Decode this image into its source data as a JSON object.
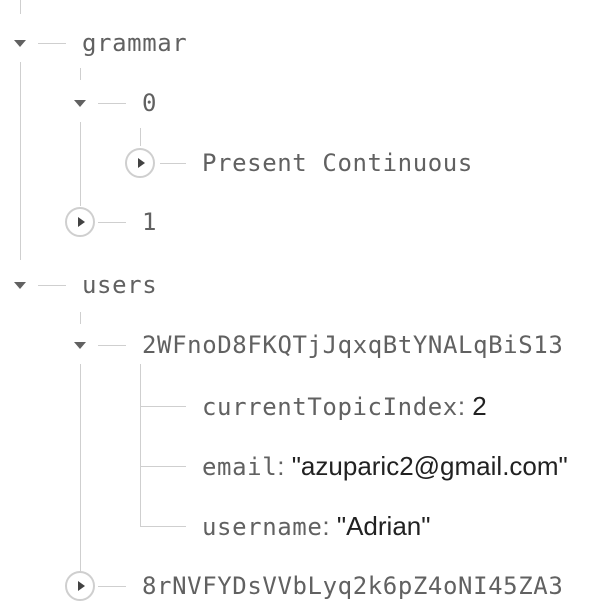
{
  "tree": {
    "grammar": {
      "key": "grammar",
      "items": [
        {
          "key": "0",
          "children": [
            {
              "key": "Present Continuous"
            }
          ]
        },
        {
          "key": "1"
        }
      ]
    },
    "users": {
      "key": "users",
      "items": [
        {
          "key": "2WFnoD8FKQTjJqxqBtYNALqBiS13",
          "fields": [
            {
              "key": "currentTopicIndex",
              "separator": ": ",
              "value": "2"
            },
            {
              "key": "email",
              "separator": ": ",
              "value": "\"azuparic2@gmail.com\""
            },
            {
              "key": "username",
              "separator": ": ",
              "value": "\"Adrian\""
            }
          ]
        },
        {
          "key": "8rNVFYDsVVbLyq2k6pZ4oNI45ZA3"
        }
      ]
    }
  },
  "colors": {
    "line": "#cfcfcf",
    "key_text": "#616161",
    "value_text": "#212121"
  },
  "icons": {
    "expanded": "caret-down-icon",
    "collapsed": "expand-circle-icon"
  }
}
